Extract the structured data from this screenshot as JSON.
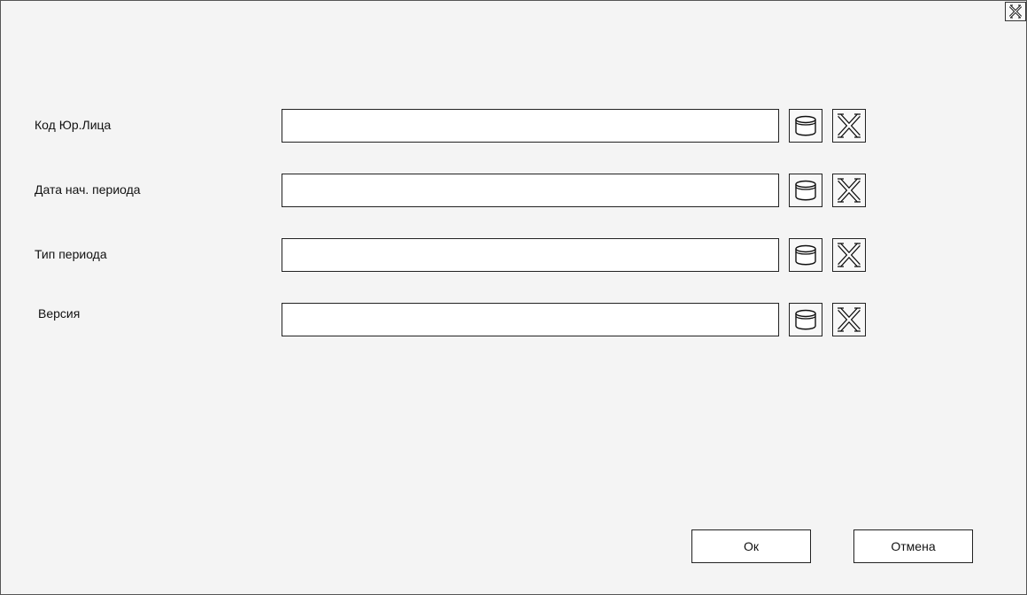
{
  "window": {
    "close_icon": "close-icon"
  },
  "fields": [
    {
      "label": "Код Юр.Лица",
      "value": "",
      "lookup_icon": "database-icon",
      "clear_icon": "clear-x-icon"
    },
    {
      "label": "Дата нач. периода",
      "value": "",
      "lookup_icon": "database-icon",
      "clear_icon": "clear-x-icon"
    },
    {
      "label": "Тип периода",
      "value": "",
      "lookup_icon": "database-icon",
      "clear_icon": "clear-x-icon"
    },
    {
      "label": "Версия",
      "value": "",
      "lookup_icon": "database-icon",
      "clear_icon": "clear-x-icon"
    }
  ],
  "buttons": {
    "ok_label": "Ок",
    "cancel_label": "Отмена"
  }
}
